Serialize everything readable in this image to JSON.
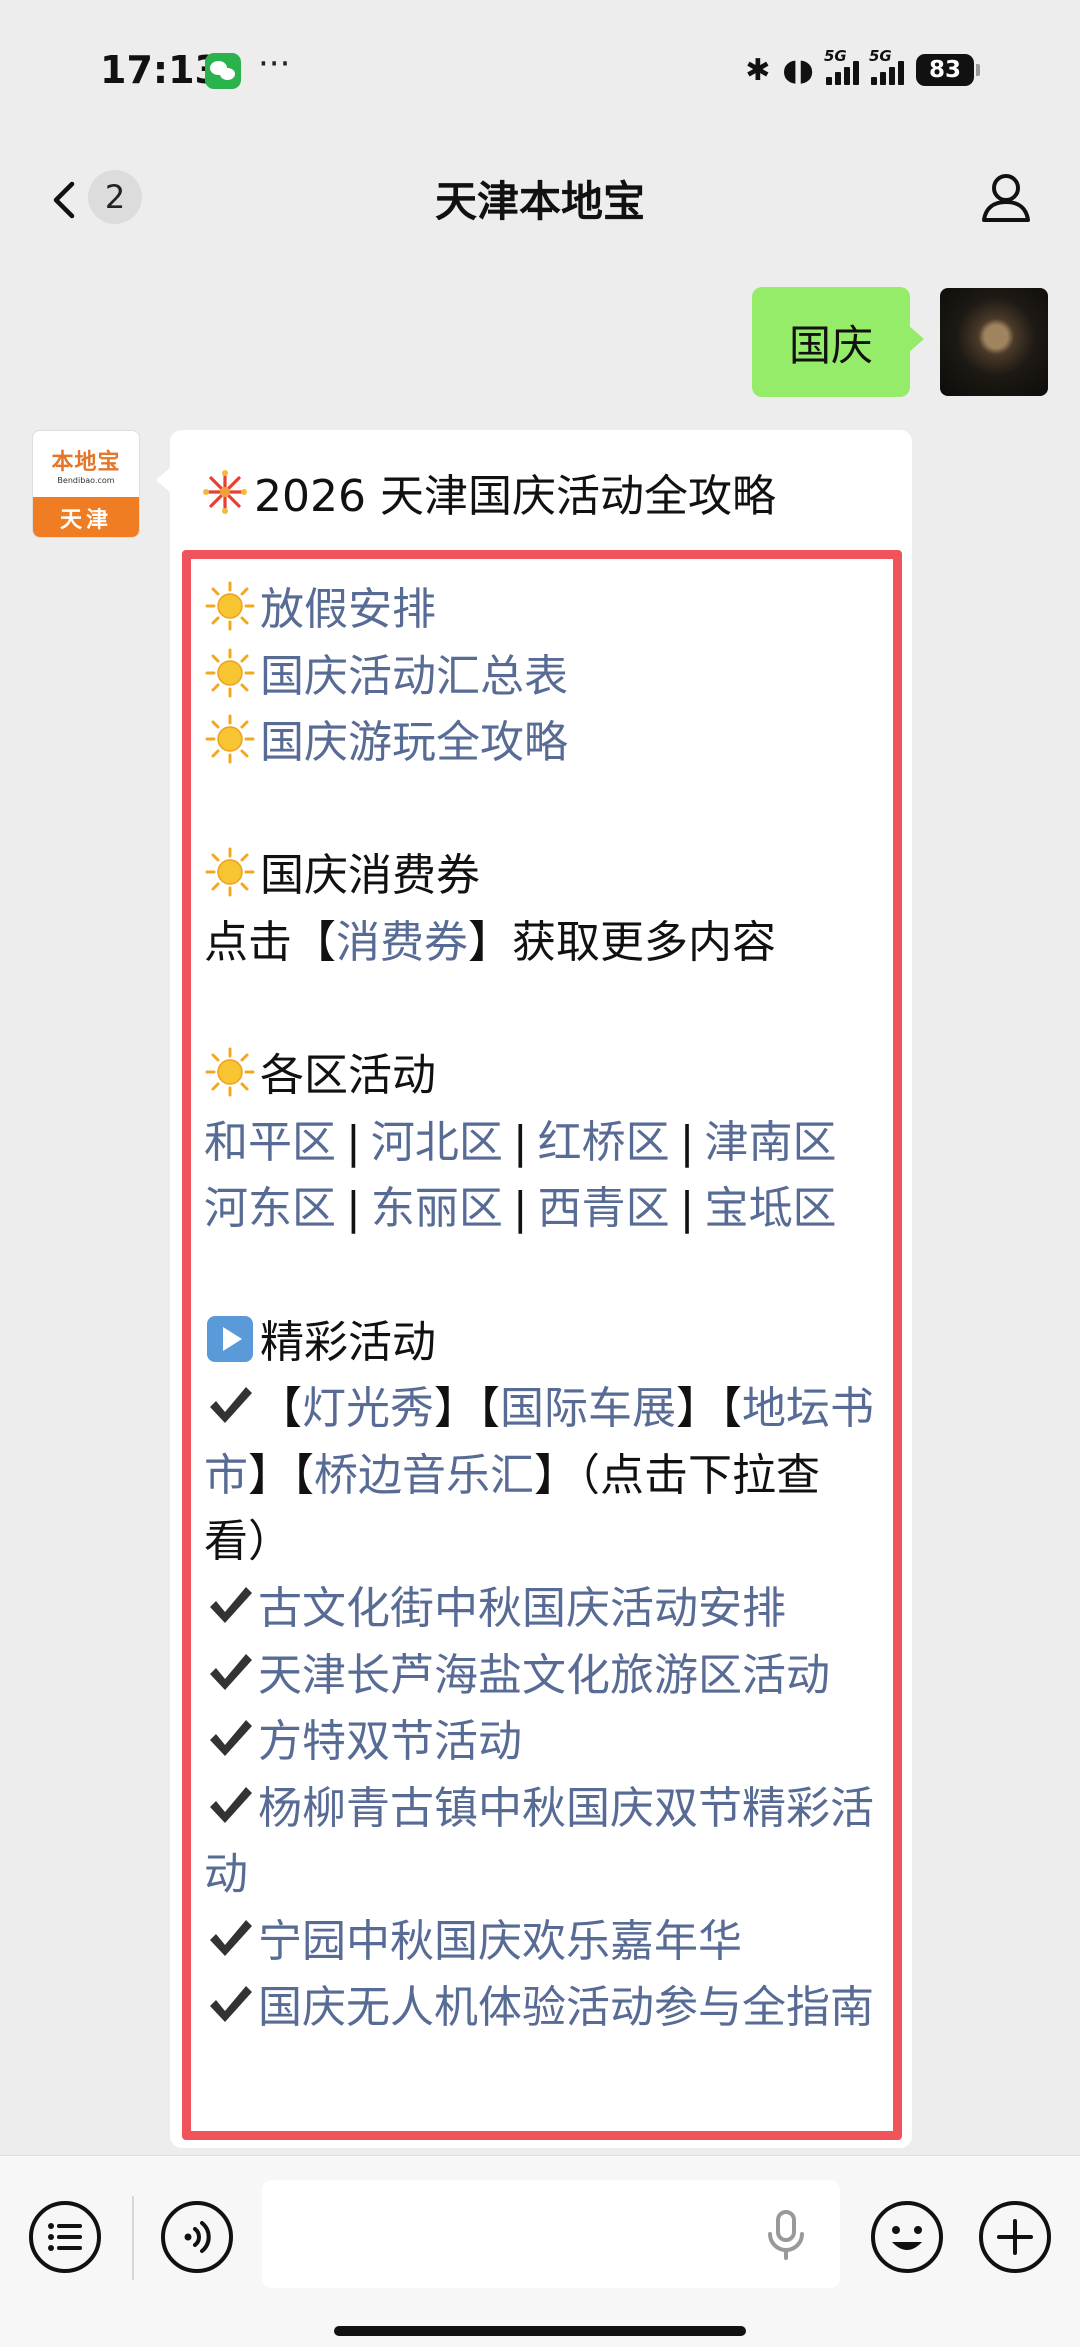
{
  "status_bar": {
    "time": "17:13",
    "dots": "···",
    "network_label": "5G",
    "battery": "83"
  },
  "nav": {
    "back_badge": "2",
    "title": "天津本地宝"
  },
  "user_message": {
    "text": "国庆"
  },
  "bot_avatar": {
    "logo_text": "本地宝",
    "logo_domain": "Bendibao.com",
    "city": "天津"
  },
  "bot_message": {
    "title": "2026 天津国庆活动全攻略",
    "quick_links": [
      "放假安排",
      "国庆活动汇总表",
      "国庆游玩全攻略"
    ],
    "coupon": {
      "heading": "国庆消费券",
      "prefix": "点击【",
      "link": "消费券",
      "suffix": "】获取更多内容"
    },
    "districts": {
      "heading": "各区活动",
      "separator": "|",
      "row1": [
        "和平区",
        "河北区",
        "红桥区",
        "津南区"
      ],
      "row2": [
        "河东区",
        "东丽区",
        "西青区",
        "宝坻区"
      ]
    },
    "events": {
      "heading": "精彩活动",
      "tags": [
        "灯光秀",
        "国际车展",
        "地坛书市",
        "桥边音乐汇"
      ],
      "bracket_open": "【",
      "bracket_close": "】",
      "hint": "（点击下拉查看）",
      "items": [
        "古文化街中秋国庆活动安排",
        "天津长芦海盐文化旅游区活动",
        "方特双节活动",
        "杨柳青古镇中秋国庆双节精彩活动",
        "宁园中秋国庆欢乐嘉年华",
        "国庆无人机体验活动参与全指南"
      ]
    }
  },
  "colors": {
    "link": "#576b95",
    "highlight_border": "#f0535a",
    "user_bubble": "#95ec69",
    "background": "#ededed"
  },
  "icons": {
    "back": "chevron-left-icon",
    "profile": "user-icon",
    "menu": "list-icon",
    "voice": "voice-icon",
    "mic": "microphone-icon",
    "emoji": "emoji-icon",
    "add": "plus-icon"
  }
}
